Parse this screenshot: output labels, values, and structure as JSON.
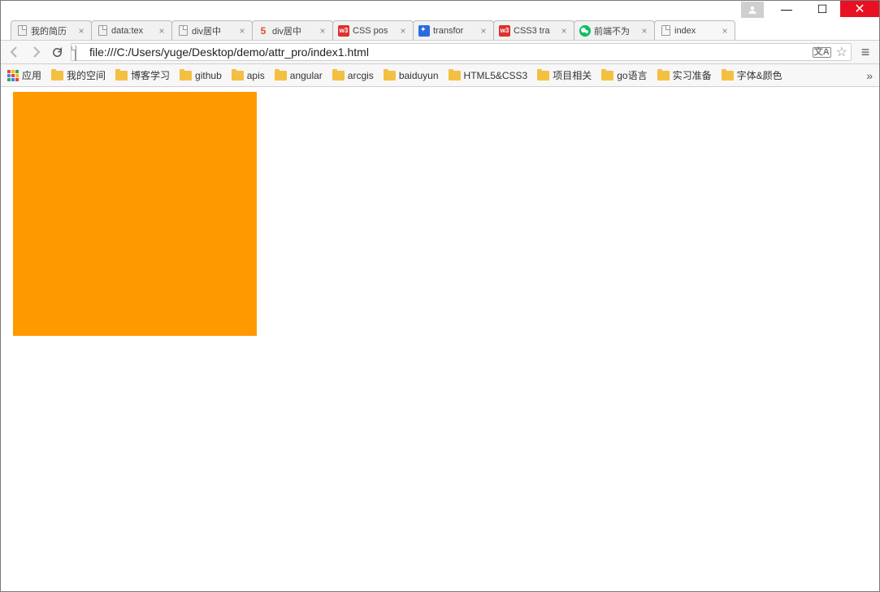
{
  "window": {
    "minimize": "—",
    "maximize": "☐",
    "close": "✕"
  },
  "tabs": [
    {
      "title": "我的简历",
      "favicon": "doc",
      "active": false
    },
    {
      "title": "data:tex",
      "favicon": "doc",
      "active": false
    },
    {
      "title": "div居中",
      "favicon": "doc",
      "active": false
    },
    {
      "title": "div居中",
      "favicon": "html5",
      "active": false
    },
    {
      "title": "CSS pos",
      "favicon": "w3",
      "active": false
    },
    {
      "title": "transfor",
      "favicon": "baidu",
      "active": false
    },
    {
      "title": "CSS3 tra",
      "favicon": "w3",
      "active": false
    },
    {
      "title": "前端不为",
      "favicon": "wx",
      "active": false
    },
    {
      "title": "index",
      "favicon": "doc",
      "active": true
    }
  ],
  "omnibox": {
    "url": "file:///C:/Users/yuge/Desktop/demo/attr_pro/index1.html"
  },
  "bookmarks": {
    "apps_label": "应用",
    "items": [
      "我的空间",
      "博客学习",
      "github",
      "apis",
      "angular",
      "arcgis",
      "baiduyun",
      "HTML5&CSS3",
      "项目相关",
      "go语言",
      "实习准备",
      "字体&颜色"
    ]
  },
  "content": {
    "box_color": "#ff9900"
  }
}
